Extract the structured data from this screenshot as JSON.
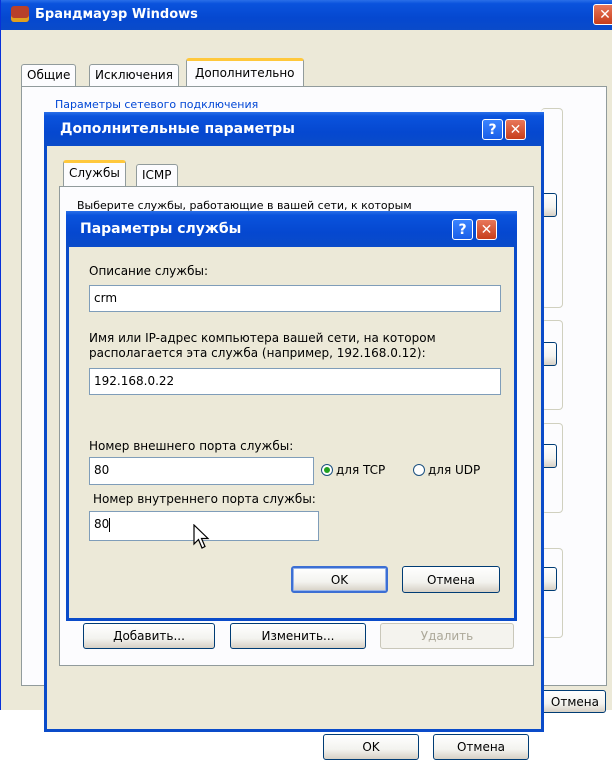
{
  "firewall_window": {
    "title": "Брандмауэр Windows",
    "tabs": [
      "Общие",
      "Исключения",
      "Дополнительно"
    ],
    "group_label": "Параметры сетевого подключения",
    "cancel_label": "Отмена"
  },
  "advanced_dialog": {
    "title": "Дополнительные параметры",
    "tabs": [
      "Службы",
      "ICMP"
    ],
    "partial_text": "Выберите службы, работающие в вашей сети, к которым",
    "add_label": "Добавить...",
    "edit_label": "Изменить...",
    "delete_label": "Удалить",
    "ok_label": "OK",
    "cancel_label": "Отмена"
  },
  "service_dialog": {
    "title": "Параметры службы",
    "description_label": "Описание службы:",
    "description_value": "crm",
    "host_label_line1": "Имя или IP-адрес компьютера вашей сети, на котором",
    "host_label_line2": "располагается эта служба (например, 192.168.0.12):",
    "host_value": "192.168.0.22",
    "external_port_label": "Номер внешнего порта службы:",
    "external_port_value": "80",
    "tcp_label": "для TCP",
    "udp_label": "для UDP",
    "internal_port_label": "Номер внутреннего порта службы:",
    "internal_port_value": "80",
    "ok_label": "OK",
    "cancel_label": "Отмена"
  },
  "colors": {
    "title_bar": "#0548d0",
    "dialog_bg": "#ece9d8",
    "tab_highlight": "#ffc83c",
    "radio_selected": "#21a121"
  }
}
